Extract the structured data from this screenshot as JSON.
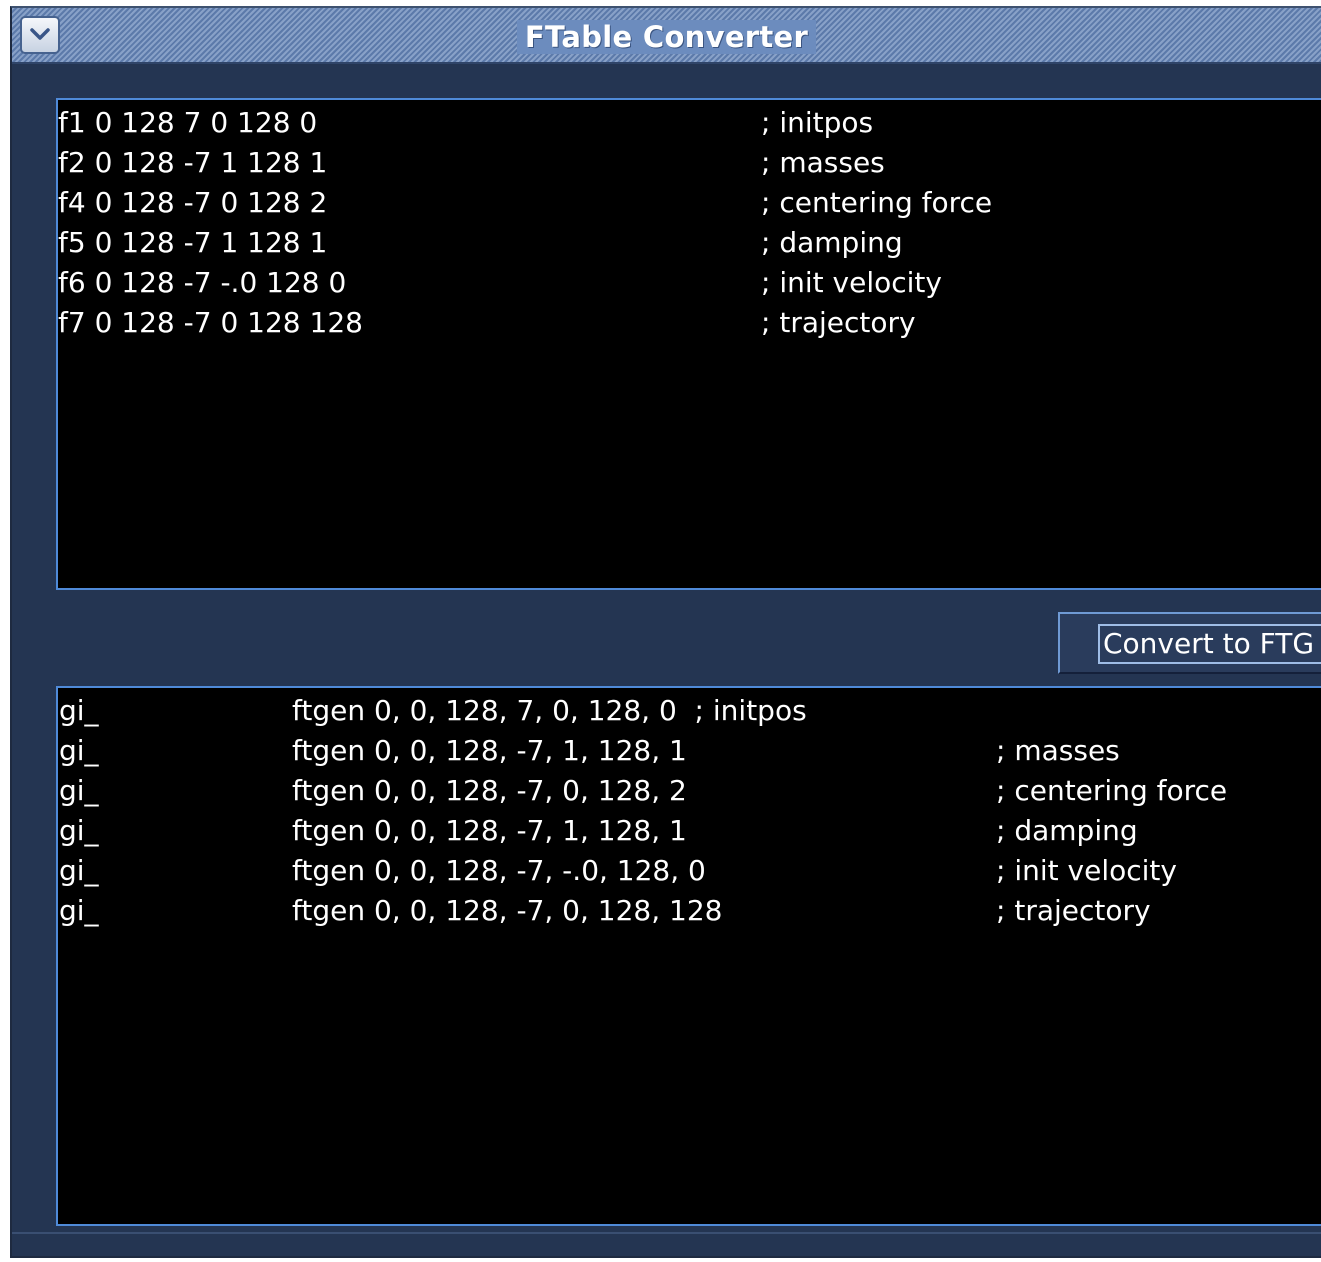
{
  "window": {
    "title": "FTable Converter"
  },
  "input_table": {
    "rows": [
      {
        "code": "f1 0 128 7 0 128 0",
        "comment": "; initpos"
      },
      {
        "code": "f2 0 128 -7 1 128 1",
        "comment": "; masses"
      },
      {
        "code": "f4 0 128 -7 0 128 2",
        "comment": "; centering force"
      },
      {
        "code": "f5 0 128 -7 1 128 1",
        "comment": "; damping"
      },
      {
        "code": "f6 0 128 -7 -.0 128 0",
        "comment": "; init velocity"
      },
      {
        "code": "f7 0 128 -7 0 128 128",
        "comment": "; trajectory"
      }
    ]
  },
  "convert_button": {
    "label": "Convert to FTG"
  },
  "output_table": {
    "rows": [
      {
        "var": "gi_",
        "code": "ftgen 0, 0, 128, 7, 0, 128, 0  ; initpos",
        "comment": ""
      },
      {
        "var": "gi_",
        "code": "ftgen 0, 0, 128, -7, 1, 128, 1",
        "comment": "; masses"
      },
      {
        "var": "gi_",
        "code": "ftgen 0, 0, 128, -7, 0, 128, 2",
        "comment": "; centering force"
      },
      {
        "var": "gi_",
        "code": "ftgen 0, 0, 128, -7, 1, 128, 1",
        "comment": "; damping"
      },
      {
        "var": "gi_",
        "code": "ftgen 0, 0, 128, -7, -.0, 128, 0",
        "comment": "; init velocity"
      },
      {
        "var": "gi_",
        "code": "ftgen 0, 0, 128, -7, 0, 128, 128",
        "comment": "; trajectory"
      }
    ]
  },
  "icons": {
    "window_menu": "chevron-down-icon"
  },
  "colors": {
    "window_bg": "#243552",
    "titlebar": "#6787b9",
    "text_area_bg": "#000000",
    "text_area_border": "#4f8ad8",
    "text": "#ffffff"
  }
}
